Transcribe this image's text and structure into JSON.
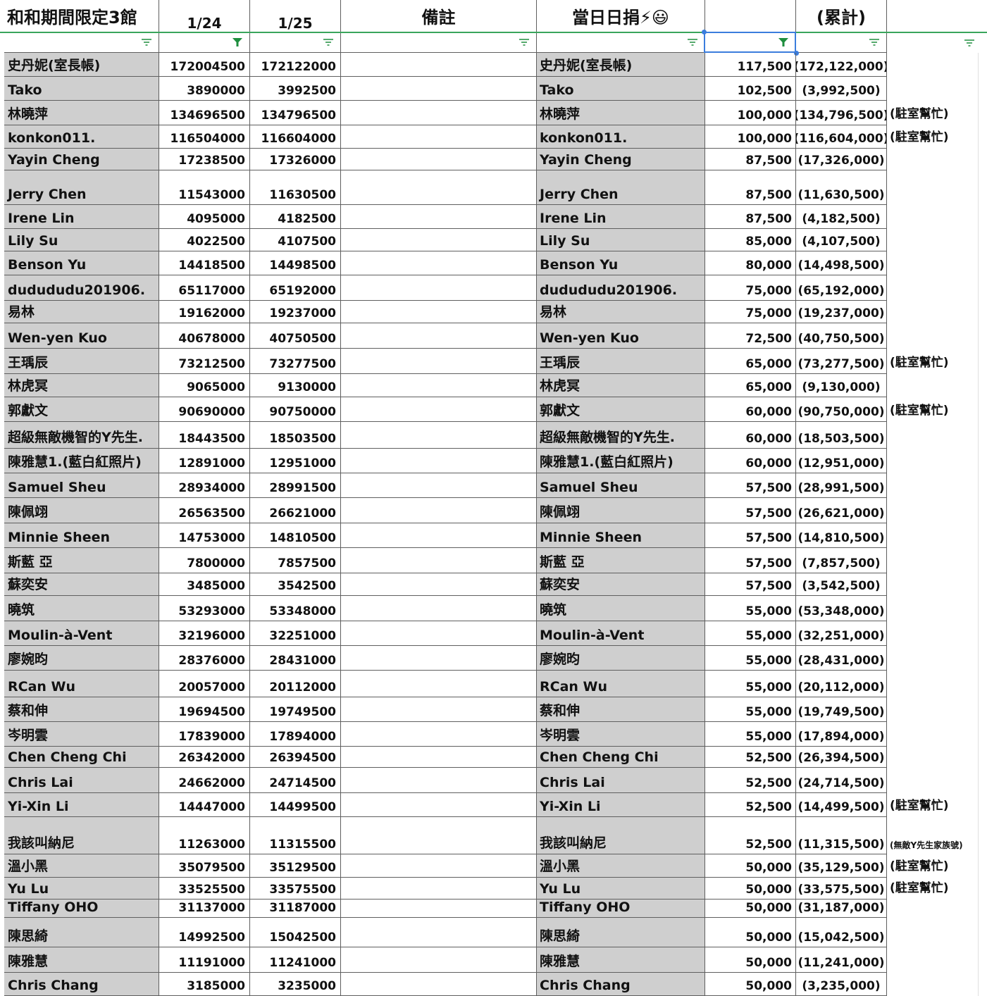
{
  "header": {
    "title": "和和期間限定3館",
    "col_date1": "1/24",
    "col_date2": "1/25",
    "col_note": "備註",
    "col_daily": "當日日捐⚡😃",
    "col_cumulative": "(累計)"
  },
  "rows": [
    {
      "name": "史丹妮(室長帳)",
      "v1": "172004500",
      "v2": "172122000",
      "name2": "史丹妮(室長帳)",
      "daily": "117,500",
      "cum": "(172,122,000)",
      "extra": ""
    },
    {
      "name": "Tako",
      "v1": "3890000",
      "v2": "3992500",
      "name2": "Tako",
      "daily": "102,500",
      "cum": "(3,992,500)",
      "extra": ""
    },
    {
      "name": "林曉萍",
      "v1": "134696500",
      "v2": "134796500",
      "name2": "林曉萍",
      "daily": "100,000",
      "cum": "(134,796,500)",
      "extra": "(駐室幫忙)"
    },
    {
      "name": "konkon011.",
      "v1": "116504000",
      "v2": "116604000",
      "name2": "konkon011.",
      "daily": "100,000",
      "cum": "(116,604,000)",
      "extra": "(駐室幫忙)"
    },
    {
      "name": "Yayin Cheng",
      "v1": "17238500",
      "v2": "17326000",
      "name2": "Yayin Cheng",
      "daily": "87,500",
      "cum": "(17,326,000)",
      "extra": ""
    },
    {
      "name": "Jerry Chen",
      "v1": "11543000",
      "v2": "11630500",
      "name2": "Jerry Chen",
      "daily": "87,500",
      "cum": "(11,630,500)",
      "extra": ""
    },
    {
      "name": "Irene Lin",
      "v1": "4095000",
      "v2": "4182500",
      "name2": "Irene Lin",
      "daily": "87,500",
      "cum": "(4,182,500)",
      "extra": ""
    },
    {
      "name": "Lily Su",
      "v1": "4022500",
      "v2": "4107500",
      "name2": "Lily Su",
      "daily": "85,000",
      "cum": "(4,107,500)",
      "extra": ""
    },
    {
      "name": "Benson Yu",
      "v1": "14418500",
      "v2": "14498500",
      "name2": "Benson Yu",
      "daily": "80,000",
      "cum": "(14,498,500)",
      "extra": ""
    },
    {
      "name": "dudududu201906.",
      "v1": "65117000",
      "v2": "65192000",
      "name2": "dudududu201906.",
      "daily": "75,000",
      "cum": "(65,192,000)",
      "extra": ""
    },
    {
      "name": "易林",
      "v1": "19162000",
      "v2": "19237000",
      "name2": "易林",
      "daily": "75,000",
      "cum": "(19,237,000)",
      "extra": ""
    },
    {
      "name": "Wen-yen Kuo",
      "v1": "40678000",
      "v2": "40750500",
      "name2": "Wen-yen Kuo",
      "daily": "72,500",
      "cum": "(40,750,500)",
      "extra": ""
    },
    {
      "name": "王瑀辰",
      "v1": "73212500",
      "v2": "73277500",
      "name2": "王瑀辰",
      "daily": "65,000",
      "cum": "(73,277,500)",
      "extra": "(駐室幫忙)"
    },
    {
      "name": "林虎冥",
      "v1": "9065000",
      "v2": "9130000",
      "name2": "林虎冥",
      "daily": "65,000",
      "cum": "(9,130,000)",
      "extra": ""
    },
    {
      "name": "郭獻文",
      "v1": "90690000",
      "v2": "90750000",
      "name2": "郭獻文",
      "daily": "60,000",
      "cum": "(90,750,000)",
      "extra": "(駐室幫忙)"
    },
    {
      "name": "超級無敵機智的Y先生.",
      "v1": "18443500",
      "v2": "18503500",
      "name2": "超級無敵機智的Y先生.",
      "daily": "60,000",
      "cum": "(18,503,500)",
      "extra": ""
    },
    {
      "name": "陳雅慧1.(藍白紅照片)",
      "v1": "12891000",
      "v2": "12951000",
      "name2": "陳雅慧1.(藍白紅照片)",
      "daily": "60,000",
      "cum": "(12,951,000)",
      "extra": ""
    },
    {
      "name": "Samuel Sheu",
      "v1": "28934000",
      "v2": "28991500",
      "name2": "Samuel Sheu",
      "daily": "57,500",
      "cum": "(28,991,500)",
      "extra": ""
    },
    {
      "name": "陳佩翊",
      "v1": "26563500",
      "v2": "26621000",
      "name2": "陳佩翊",
      "daily": "57,500",
      "cum": "(26,621,000)",
      "extra": ""
    },
    {
      "name": "Minnie Sheen",
      "v1": "14753000",
      "v2": "14810500",
      "name2": "Minnie Sheen",
      "daily": "57,500",
      "cum": "(14,810,500)",
      "extra": ""
    },
    {
      "name": "斯藍 亞",
      "v1": "7800000",
      "v2": "7857500",
      "name2": "斯藍 亞",
      "daily": "57,500",
      "cum": "(7,857,500)",
      "extra": ""
    },
    {
      "name": "蘇奕安",
      "v1": "3485000",
      "v2": "3542500",
      "name2": "蘇奕安",
      "daily": "57,500",
      "cum": "(3,542,500)",
      "extra": ""
    },
    {
      "name": "曉筑",
      "v1": "53293000",
      "v2": "53348000",
      "name2": "曉筑",
      "daily": "55,000",
      "cum": "(53,348,000)",
      "extra": ""
    },
    {
      "name": "Moulin-à-Vent",
      "v1": "32196000",
      "v2": "32251000",
      "name2": "Moulin-à-Vent",
      "daily": "55,000",
      "cum": "(32,251,000)",
      "extra": ""
    },
    {
      "name": "廖婉昀",
      "v1": "28376000",
      "v2": "28431000",
      "name2": "廖婉昀",
      "daily": "55,000",
      "cum": "(28,431,000)",
      "extra": ""
    },
    {
      "name": "RCan Wu",
      "v1": "20057000",
      "v2": "20112000",
      "name2": "RCan Wu",
      "daily": "55,000",
      "cum": "(20,112,000)",
      "extra": ""
    },
    {
      "name": "蔡和伸",
      "v1": "19694500",
      "v2": "19749500",
      "name2": "蔡和伸",
      "daily": "55,000",
      "cum": "(19,749,500)",
      "extra": ""
    },
    {
      "name": "岑明雲",
      "v1": "17839000",
      "v2": "17894000",
      "name2": "岑明雲",
      "daily": "55,000",
      "cum": "(17,894,000)",
      "extra": ""
    },
    {
      "name": "Chen Cheng Chi",
      "v1": "26342000",
      "v2": "26394500",
      "name2": "Chen Cheng Chi",
      "daily": "52,500",
      "cum": "(26,394,500)",
      "extra": ""
    },
    {
      "name": "Chris Lai",
      "v1": "24662000",
      "v2": "24714500",
      "name2": "Chris Lai",
      "daily": "52,500",
      "cum": "(24,714,500)",
      "extra": ""
    },
    {
      "name": "Yi-Xin Li",
      "v1": "14447000",
      "v2": "14499500",
      "name2": "Yi-Xin Li",
      "daily": "52,500",
      "cum": "(14,499,500)",
      "extra": "(駐室幫忙)"
    },
    {
      "name": "我該叫納尼",
      "v1": "11263000",
      "v2": "11315500",
      "name2": "我該叫納尼",
      "daily": "52,500",
      "cum": "(11,315,500)",
      "extra": "(無敵Y先生家族號)",
      "extra_small": true
    },
    {
      "name": "溫小黑",
      "v1": "35079500",
      "v2": "35129500",
      "name2": "溫小黑",
      "daily": "50,000",
      "cum": "(35,129,500)",
      "extra": "(駐室幫忙)"
    },
    {
      "name": "Yu Lu",
      "v1": "33525500",
      "v2": "33575500",
      "name2": "Yu Lu",
      "daily": "50,000",
      "cum": "(33,575,500)",
      "extra": "(駐室幫忙)"
    },
    {
      "name": "Tiffany OHO",
      "v1": "31137000",
      "v2": "31187000",
      "name2": "Tiffany OHO",
      "daily": "50,000",
      "cum": "(31,187,000)",
      "extra": ""
    },
    {
      "name": "陳思綺",
      "v1": "14992500",
      "v2": "15042500",
      "name2": "陳思綺",
      "daily": "50,000",
      "cum": "(15,042,500)",
      "extra": ""
    },
    {
      "name": "陳雅慧",
      "v1": "11191000",
      "v2": "11241000",
      "name2": "陳雅慧",
      "daily": "50,000",
      "cum": "(11,241,000)",
      "extra": ""
    },
    {
      "name": "Chris Chang",
      "v1": "3185000",
      "v2": "3235000",
      "name2": "Chris Chang",
      "daily": "50,000",
      "cum": "(3,235,000)",
      "extra": ""
    }
  ],
  "colors": {
    "name_fill": "#cfcfcf",
    "grid": "#5f5f5f",
    "filter_icon": "#1e8e3e",
    "selection": "#3b7ddd"
  }
}
